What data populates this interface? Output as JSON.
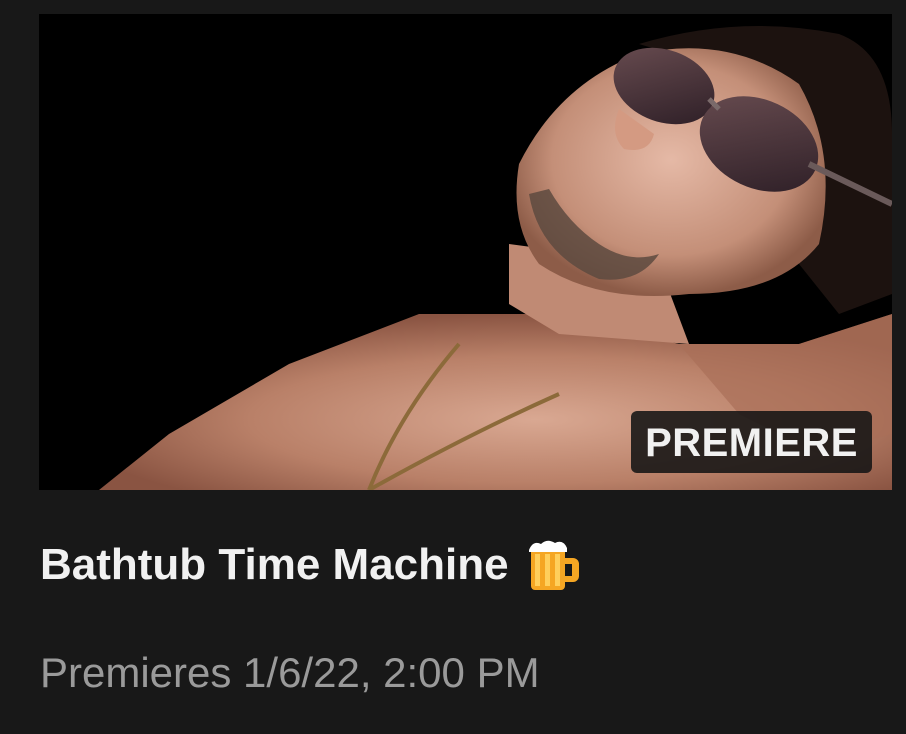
{
  "video": {
    "thumbnail_icon": "person-photo",
    "badge": "PREMIERE",
    "title": "Bathtub Time Machine",
    "title_emoji": "beer-mug-icon",
    "meta": "Premieres 1/6/22, 2:00 PM"
  },
  "colors": {
    "background": "#181818",
    "title": "#f1f1f1",
    "meta": "#9a9a9a",
    "badge_bg": "#141414"
  }
}
